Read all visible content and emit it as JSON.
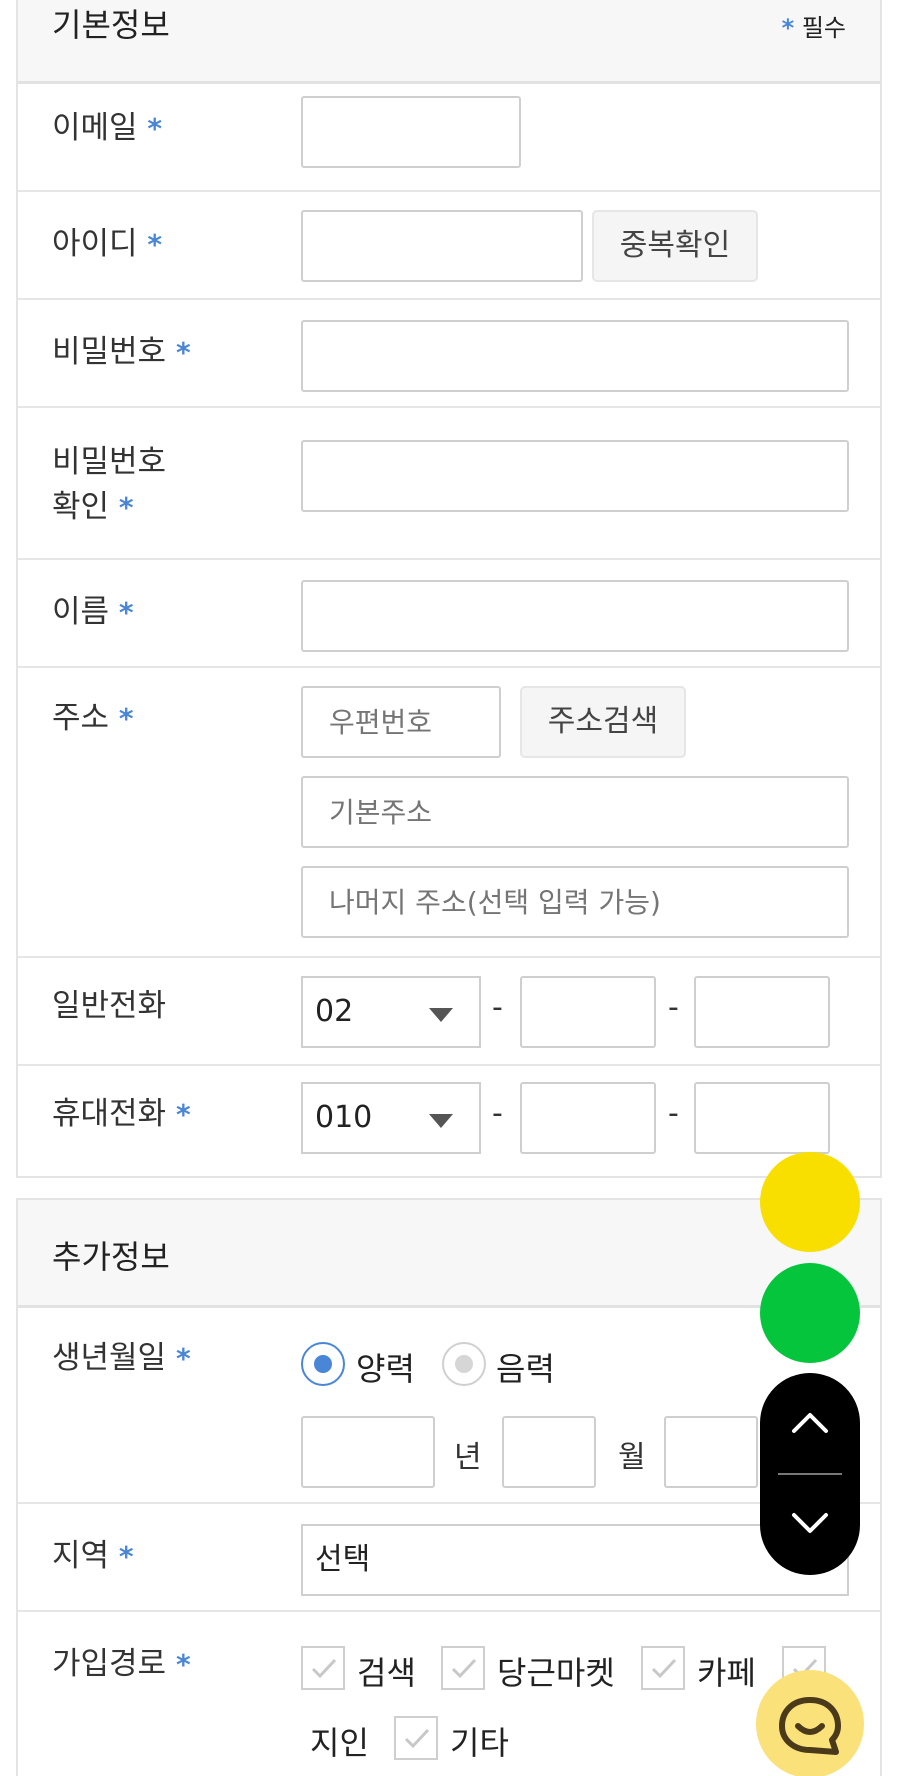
{
  "basic": {
    "title": "기본정보",
    "required_star": "*",
    "required_text": "필수",
    "email_label": "이메일",
    "id_label": "아이디",
    "dup_check_button": "중복확인",
    "password_label": "비밀번호",
    "password_confirm_label_1": "비밀번호",
    "password_confirm_label_2": "확인",
    "name_label": "이름",
    "address_label": "주소",
    "zip_placeholder": "우편번호",
    "address_search_button": "주소검색",
    "address1_placeholder": "기본주소",
    "address2_placeholder": "나머지 주소(선택 입력 가능)",
    "phone_label": "일반전화",
    "phone_prefix": "02",
    "mobile_label": "휴대전화",
    "mobile_prefix": "010",
    "dash": "-"
  },
  "extra": {
    "title": "추가정보",
    "birth_label": "생년월일",
    "solar_label": "양력",
    "lunar_label": "음력",
    "birth_calendar_selected": "양력",
    "year_unit": "년",
    "month_unit": "월",
    "region_label": "지역",
    "region_value": "선택",
    "signup_path_label": "가입경로",
    "signup_paths": [
      "검색",
      "당근마켓",
      "카페",
      "지인",
      "기타"
    ]
  },
  "floating": {
    "yellow_button_color": "#f9df00",
    "green_button_color": "#05c53d",
    "scroll_up_icon": "chevron-up-icon",
    "scroll_down_icon": "chevron-down-icon",
    "chat_icon": "chat-smile-icon"
  },
  "colors": {
    "accent": "#4a86d6",
    "border": "#e4e4e4",
    "header_bg": "#f7f7f7"
  }
}
